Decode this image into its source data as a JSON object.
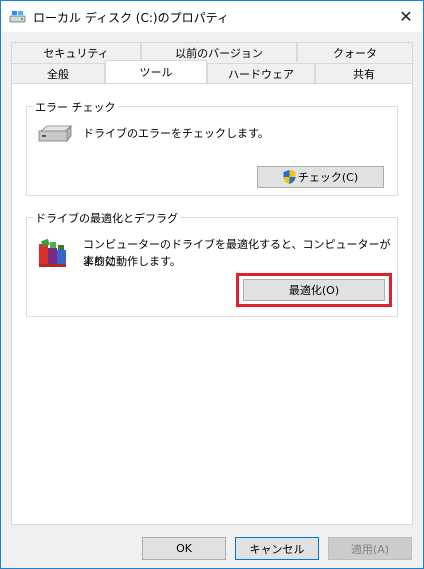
{
  "window": {
    "title": "ローカル ディスク (C:)のプロパティ",
    "title_icon": "drive-icon",
    "close_glyph": "✕"
  },
  "tabs": {
    "row1": [
      {
        "label": "セキュリティ"
      },
      {
        "label": "以前のバージョン"
      },
      {
        "label": "クォータ"
      }
    ],
    "row2": [
      {
        "label": "全般"
      },
      {
        "label": "ツール",
        "active": true
      },
      {
        "label": "ハードウェア"
      },
      {
        "label": "共有"
      }
    ]
  },
  "error_check": {
    "group_label": "エラー チェック",
    "icon": "hard-drive-icon",
    "description": "ドライブのエラーをチェックします。",
    "button_label": "チェック(C)",
    "button_icon": "uac-shield-icon"
  },
  "optimize": {
    "group_label": "ドライブの最適化とデフラグ",
    "icon": "defrag-icon",
    "description_line1": "コンピューターのドライブを最適化すると、コンピューターがより効",
    "description_line2": "率的に動作します。",
    "button_label": "最適化(O)",
    "highlight_color": "#e0202a"
  },
  "footer": {
    "ok_label": "OK",
    "cancel_label": "キャンセル",
    "apply_label": "適用(A)"
  }
}
